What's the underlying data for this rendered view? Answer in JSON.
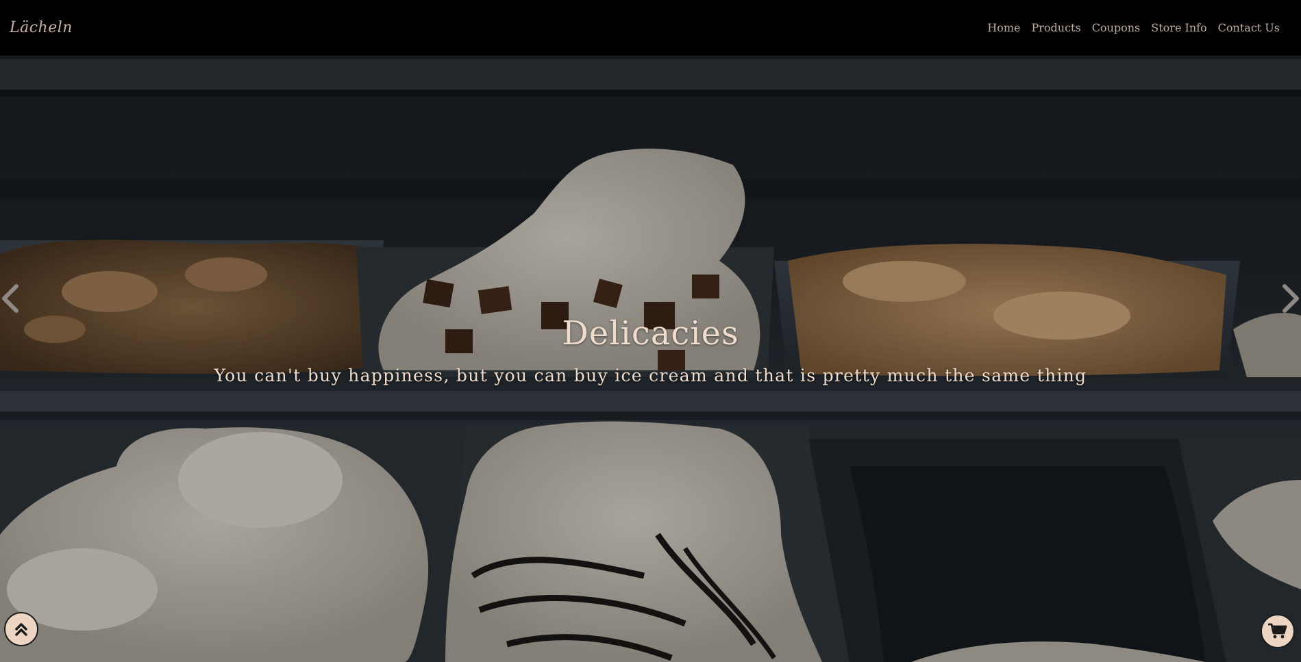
{
  "navbar": {
    "brand": "Lächeln",
    "links": [
      "Home",
      "Products",
      "Coupons",
      "Store Info",
      "Contact Us"
    ]
  },
  "carousel": {
    "title": "Delicacies",
    "subtitle": "You can't buy happiness, but you can buy ice cream and that is pretty much the same thing",
    "prev_icon": "chevron-left-icon",
    "next_icon": "chevron-right-icon"
  },
  "floating_buttons": {
    "scroll_top_icon": "double-chevron-up-icon",
    "cart_icon": "cart-icon"
  },
  "colors": {
    "accent": "#ecd5c3",
    "caption_text": "#efdccd",
    "nav_background": "#000000"
  }
}
